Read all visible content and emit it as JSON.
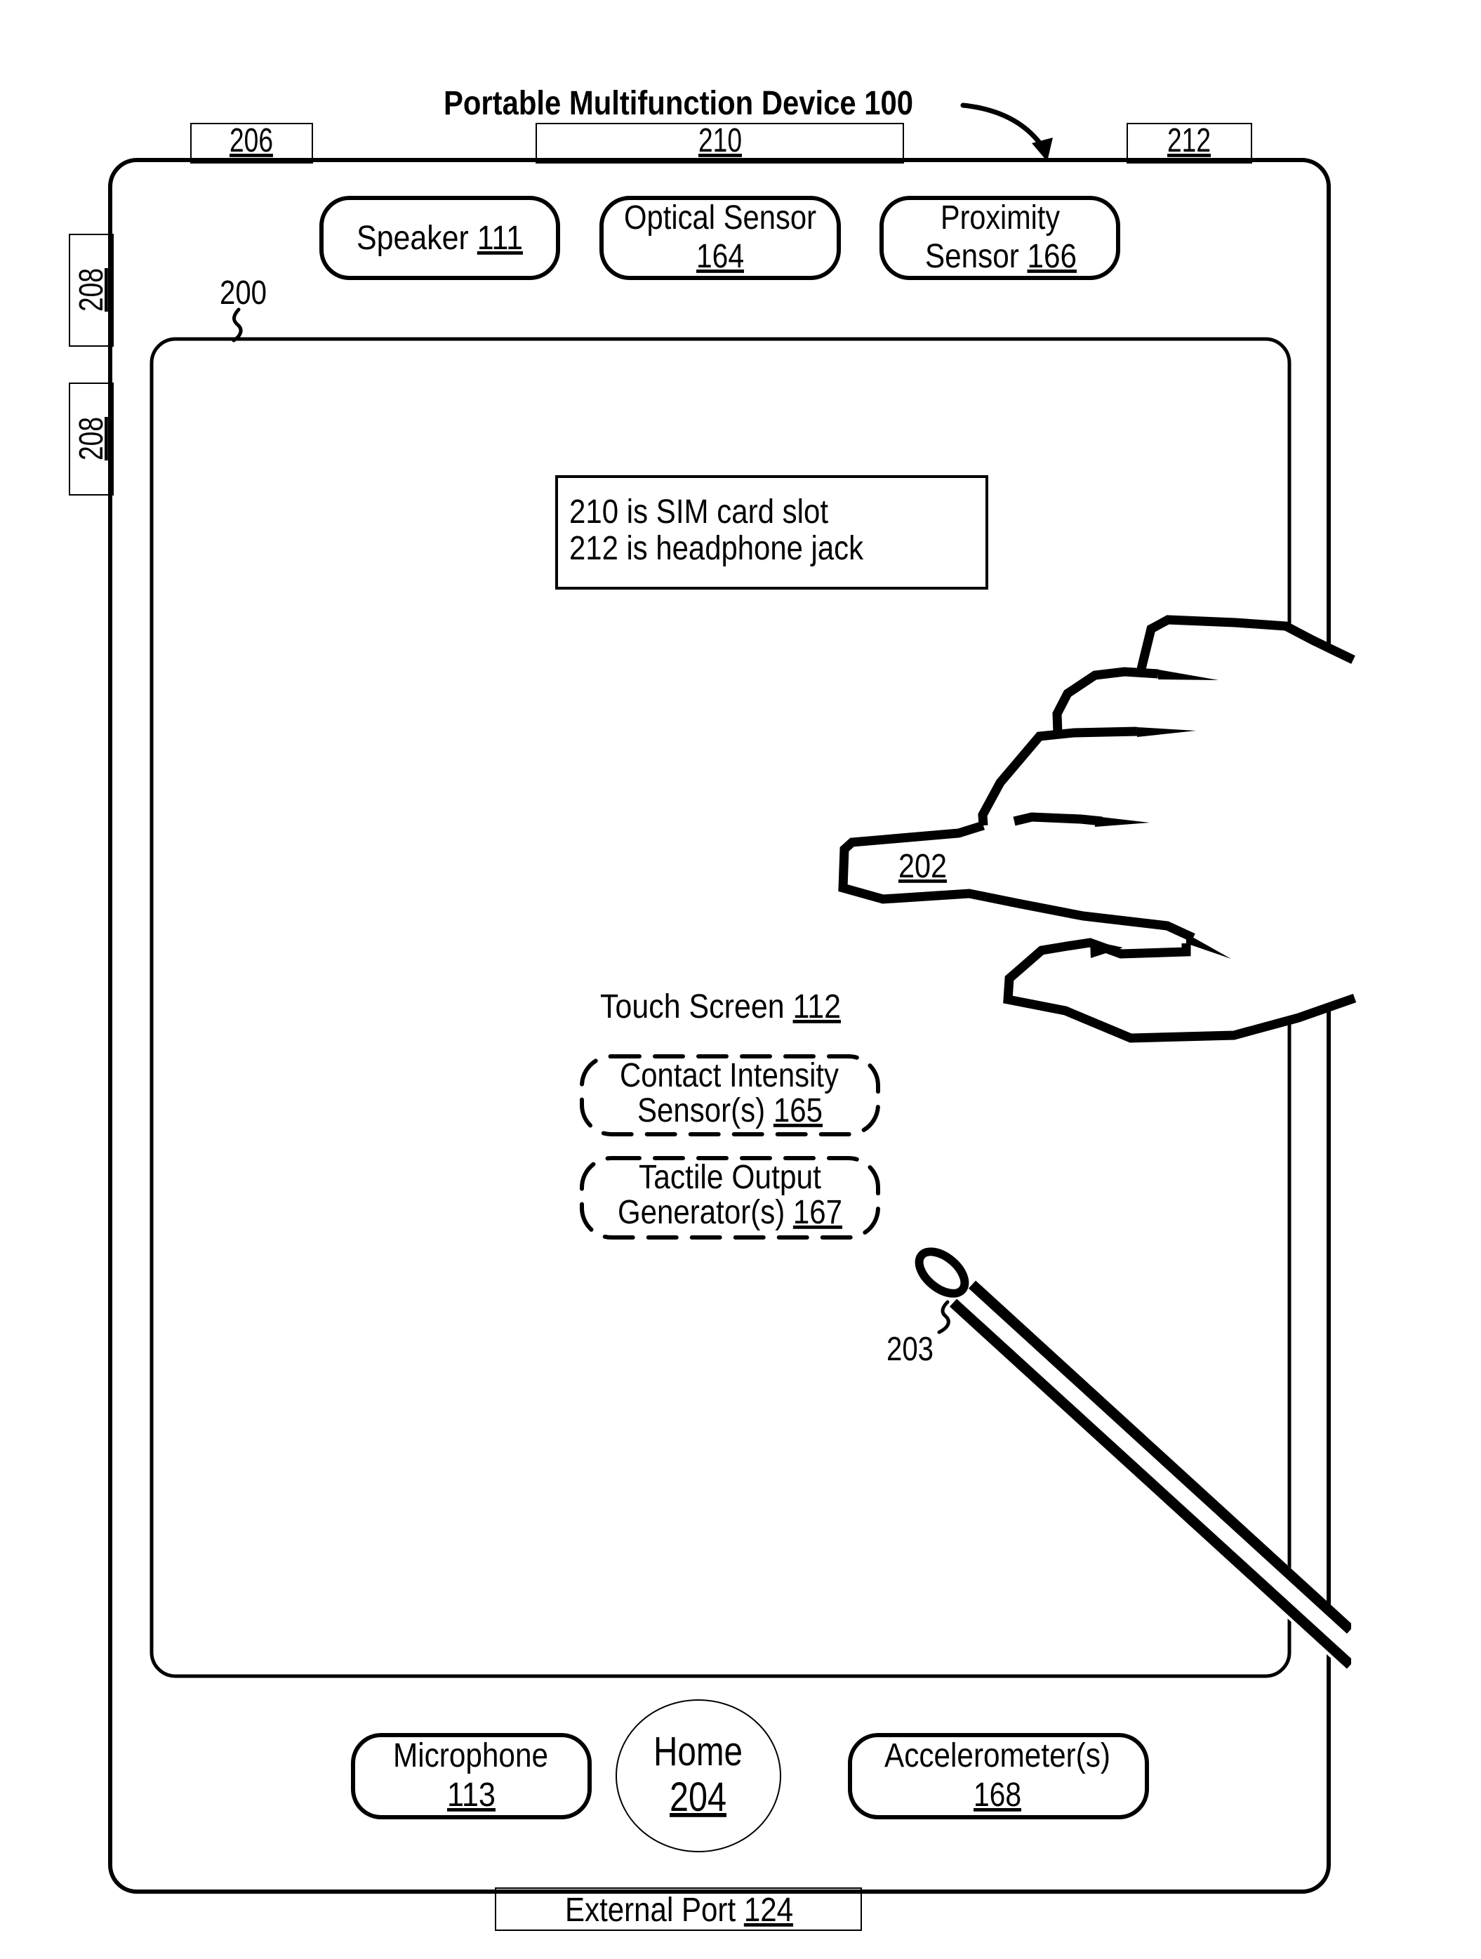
{
  "figure": {
    "title": "Portable Multifunction Device 100"
  },
  "side_parts": {
    "part_206": "206",
    "part_210": "210",
    "part_212": "212",
    "part_208_upper": "208",
    "part_208_lower": "208"
  },
  "top_components": {
    "speaker": {
      "label": "Speaker",
      "ref": "111"
    },
    "optical_sensor": {
      "label": "Optical Sensor",
      "ref": "164"
    },
    "proximity_sensor": {
      "line1": "Proximity",
      "label": "Sensor",
      "ref": "166"
    }
  },
  "screen": {
    "ref": "200",
    "note": {
      "line1": "210 is SIM card slot",
      "line2": "212 is headphone jack"
    },
    "touch_screen": {
      "label": "Touch Screen",
      "ref": "112"
    },
    "contact_intensity": {
      "line1": "Contact Intensity",
      "label": "Sensor(s)",
      "ref": "165"
    },
    "tactile_output": {
      "line1": "Tactile Output",
      "label": "Generator(s)",
      "ref": "167"
    }
  },
  "finger": {
    "ref": "202"
  },
  "stylus": {
    "ref": "203"
  },
  "bottom_components": {
    "microphone": {
      "label": "Microphone",
      "ref": "113"
    },
    "home": {
      "label": "Home",
      "ref": "204"
    },
    "accelerometer": {
      "label": "Accelerometer(s)",
      "ref": "168"
    }
  },
  "external_port": {
    "label": "External Port",
    "ref": "124"
  }
}
